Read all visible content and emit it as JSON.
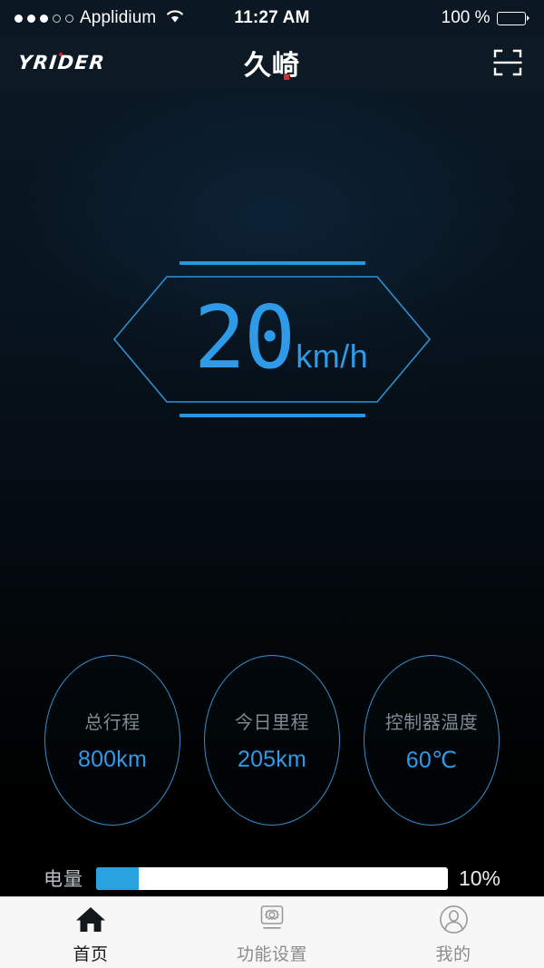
{
  "status_bar": {
    "signal_dots_filled": 3,
    "signal_dots_total": 5,
    "carrier": "Applidium",
    "wifi_icon": "wifi-icon",
    "time": "11:27 AM",
    "battery_percent": "100 %"
  },
  "header": {
    "left_logo_text": "YRIDER",
    "center_brand_text": "久崎",
    "scan_icon": "scan-qr-icon"
  },
  "speed": {
    "value": "20",
    "unit": "km/h"
  },
  "stats": [
    {
      "label": "总行程",
      "value": "800km"
    },
    {
      "label": "今日里程",
      "value": "205km"
    },
    {
      "label": "控制器温度",
      "value": "60℃"
    }
  ],
  "battery": {
    "label": "电量",
    "percent_text": "10%",
    "fill_percent": 12
  },
  "tabs": [
    {
      "label": "首页",
      "icon": "home-icon",
      "active": true
    },
    {
      "label": "功能设置",
      "icon": "gear-monitor-icon",
      "active": false
    },
    {
      "label": "我的",
      "icon": "person-circle-icon",
      "active": false
    }
  ],
  "colors": {
    "accent_blue": "#2e9ae8",
    "outline_blue": "#2e8fd0",
    "background_dark": "#050d15",
    "tabbar_bg": "#f7f7f7",
    "logo_red": "#e02020"
  }
}
